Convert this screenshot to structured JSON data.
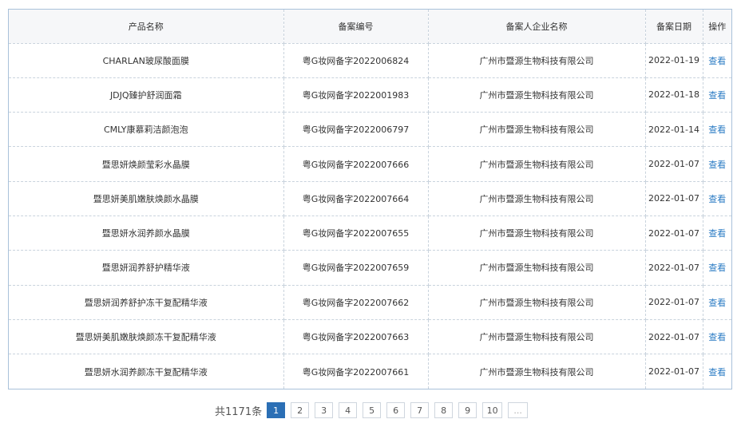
{
  "table": {
    "headers": [
      "产品名称",
      "备案编号",
      "备案人企业名称",
      "备案日期",
      "操作"
    ],
    "rows": [
      {
        "name": "CHARLAN玻尿酸面膜",
        "code": "粤G妆网备字2022006824",
        "company": "广州市暨源生物科技有限公司",
        "date": "2022-01-19",
        "action": "查看"
      },
      {
        "name": "JDJQ臻护舒润面霜",
        "code": "粤G妆网备字2022001983",
        "company": "广州市暨源生物科技有限公司",
        "date": "2022-01-18",
        "action": "查看"
      },
      {
        "name": "CMLY康慕莉洁颜泡泡",
        "code": "粤G妆网备字2022006797",
        "company": "广州市暨源生物科技有限公司",
        "date": "2022-01-14",
        "action": "查看"
      },
      {
        "name": "暨思妍焕颜莹彩水晶膜",
        "code": "粤G妆网备字2022007666",
        "company": "广州市暨源生物科技有限公司",
        "date": "2022-01-07",
        "action": "查看"
      },
      {
        "name": "暨思妍美肌嫩肤焕颜水晶膜",
        "code": "粤G妆网备字2022007664",
        "company": "广州市暨源生物科技有限公司",
        "date": "2022-01-07",
        "action": "查看"
      },
      {
        "name": "暨思妍水润养颜水晶膜",
        "code": "粤G妆网备字2022007655",
        "company": "广州市暨源生物科技有限公司",
        "date": "2022-01-07",
        "action": "查看"
      },
      {
        "name": "暨思妍润养舒护精华液",
        "code": "粤G妆网备字2022007659",
        "company": "广州市暨源生物科技有限公司",
        "date": "2022-01-07",
        "action": "查看"
      },
      {
        "name": "暨思妍润养舒护冻干复配精华液",
        "code": "粤G妆网备字2022007662",
        "company": "广州市暨源生物科技有限公司",
        "date": "2022-01-07",
        "action": "查看"
      },
      {
        "name": "暨思妍美肌嫩肤焕颜冻干复配精华液",
        "code": "粤G妆网备字2022007663",
        "company": "广州市暨源生物科技有限公司",
        "date": "2022-01-07",
        "action": "查看"
      },
      {
        "name": "暨思妍水润养颜冻干复配精华液",
        "code": "粤G妆网备字2022007661",
        "company": "广州市暨源生物科技有限公司",
        "date": "2022-01-07",
        "action": "查看"
      }
    ]
  },
  "pagination": {
    "total_label": "共1171条",
    "active_page": "1",
    "pages": [
      "2",
      "3",
      "4",
      "5",
      "6",
      "7",
      "8",
      "9",
      "10"
    ],
    "ellipsis": "..."
  },
  "colors": {
    "link": "#2c7cc4",
    "active_page_bg": "#2b6fb5",
    "border": "#a9c1da"
  }
}
